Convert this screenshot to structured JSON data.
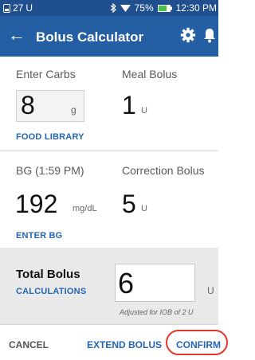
{
  "status_bar": {
    "left_text": "27",
    "left_icon": "U",
    "battery": "75%",
    "time": "12:30 PM"
  },
  "app_bar": {
    "title": "Bolus Calculator"
  },
  "carbs": {
    "label": "Enter Carbs",
    "value": "8",
    "unit": "g",
    "link": "FOOD LIBRARY"
  },
  "meal_bolus": {
    "label": "Meal Bolus",
    "value": "1",
    "unit": "U"
  },
  "bg": {
    "label": "BG (1:59 PM)",
    "value": "192",
    "unit": "mg/dL",
    "link": "ENTER BG"
  },
  "correction": {
    "label": "Correction Bolus",
    "value": "5",
    "unit": "U"
  },
  "total": {
    "label": "Total Bolus",
    "link": "CALCULATIONS",
    "value": "6",
    "unit": "U",
    "note": "Adjusted for IOB of 2 U"
  },
  "actions": {
    "cancel": "CANCEL",
    "extend": "EXTEND BOLUS",
    "confirm": "CONFIRM"
  },
  "colors": {
    "app_bar": "#245ea3",
    "status_bar": "#1f4f8f",
    "link": "#2566b4",
    "highlight": "#e2382c"
  }
}
